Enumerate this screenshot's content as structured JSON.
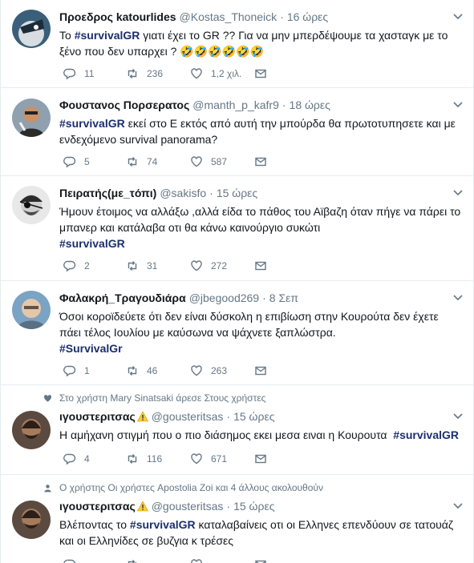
{
  "tweets": [
    {
      "name": "Προεδρος katourlides",
      "handle": "@Kostas_Thoneick",
      "time": "16 ώρες",
      "text_pre": "Το ",
      "hashtag": "#survivalGR",
      "text_post": " γιατι έχει το GR ?? Για να μην μπερδέψουμε τα χασταγκ με το ξένο που δεν υπαρχει ? 🤣🤣🤣🤣🤣🤣",
      "replies": "11",
      "retweets": "236",
      "likes": "1,2 χιλ."
    },
    {
      "name": "Φουστανος Πορσερατος",
      "handle": "@manth_p_kafr9",
      "time": "18 ώρες",
      "text_pre": "",
      "hashtag": "#survivalGR",
      "text_post": " εκεί στο Ε εκτός από αυτή την μπούρδα θα πρωτοτυπησετε και με ενδεχόμενο survival panorama?",
      "replies": "5",
      "retweets": "74",
      "likes": "587"
    },
    {
      "name": "Πειρατής(με_τόπι)",
      "handle": "@sakisfo",
      "time": "15 ώρες",
      "text_pre": "Ήμουν έτοιμος να αλλάξω ,αλλά είδα το πάθος του Αϊβαζη όταν πήγε να πάρει το μπανερ και κατάλαβα οτι θα κάνω καινούργιο συκώτι",
      "hashtag": "#survivalGR",
      "text_post": "",
      "replies": "2",
      "retweets": "31",
      "likes": "272"
    },
    {
      "name": "Φαλακρή_Τραγουδιάρα",
      "handle": "@jbegood269",
      "time": "8 Σεπ",
      "text_pre": "Όσοι κοροϊδεύετε ότι δεν είναι δύσκολη η επιβίωση στην Κουρούτα δεν έχετε πάει τέλος Ιουλίου με καύσωνα να ψάχνετε ξαπλώστρα.",
      "hashtag": "#SurvivalGr",
      "text_post": "",
      "replies": "1",
      "retweets": "46",
      "likes": "263"
    },
    {
      "context": "Στο χρήστη Mary Sinatsaki άρεσε Στους χρήστες",
      "name": "ιγουστεριτσας",
      "handle": "@gousteritsas",
      "time": "15 ώρες",
      "text_pre": "Η αμήχανη στιγμή που ο πιο διάσημος εκει μεσα ειναι η Κουρουτα  ",
      "hashtag": "#survivalGR",
      "text_post": "",
      "replies": "4",
      "retweets": "116",
      "likes": "671"
    },
    {
      "context": "Ο χρήστης Οι χρήστες Apostolia Zoi και 4 άλλους ακολουθούν",
      "name": "ιγουστεριτσας",
      "handle": "@gousteritsas",
      "time": "15 ώρες",
      "text_pre": "Βλέποντας το ",
      "hashtag": "#survivalGR",
      "text_post": " καταλαβαίνεις οτι οι Ελληνες επενδύουν σε τατουάζ και οι Ελληνίδες σε βυζγια κ τρέσες",
      "replies": "",
      "retweets": "",
      "likes": ""
    }
  ],
  "colors": {
    "hashtag": "#1b2e6e",
    "muted": "#657786",
    "like_context": "#e0245e"
  }
}
